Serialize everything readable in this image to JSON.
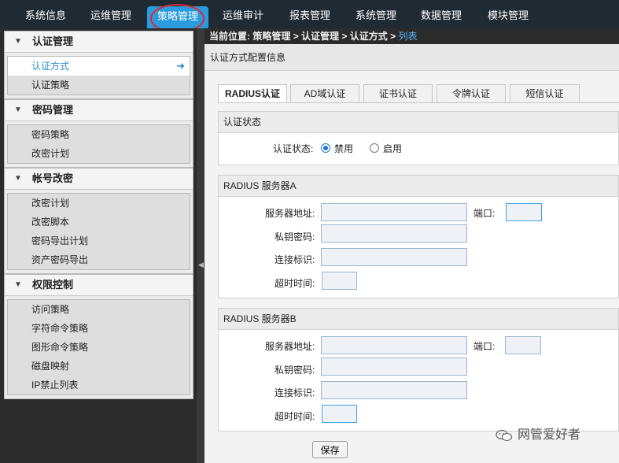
{
  "topnav": {
    "items": [
      {
        "label": "系统信息"
      },
      {
        "label": "运维管理"
      },
      {
        "label": "策略管理",
        "active": true
      },
      {
        "label": "运维审计"
      },
      {
        "label": "报表管理"
      },
      {
        "label": "系统管理"
      },
      {
        "label": "数据管理"
      },
      {
        "label": "模块管理"
      }
    ],
    "active_color": "#2a9bde"
  },
  "sidebar": {
    "groups": [
      {
        "title": "认证管理",
        "items": [
          {
            "label": "认证方式",
            "active": true
          },
          {
            "label": "认证策略"
          }
        ]
      },
      {
        "title": "密码管理",
        "items": [
          {
            "label": "密码策略"
          },
          {
            "label": "改密计划"
          }
        ]
      },
      {
        "title": "帐号改密",
        "items": [
          {
            "label": "改密计划"
          },
          {
            "label": "改密脚本"
          },
          {
            "label": "密码导出计划"
          },
          {
            "label": "资产密码导出"
          }
        ]
      },
      {
        "title": "权限控制",
        "items": [
          {
            "label": "访问策略"
          },
          {
            "label": "字符命令策略"
          },
          {
            "label": "图形命令策略"
          },
          {
            "label": "磁盘映射"
          },
          {
            "label": "IP禁止列表"
          }
        ]
      }
    ]
  },
  "breadcrumb": {
    "prefix": "当前位置: ",
    "parts": [
      "策略管理",
      "认证管理",
      "认证方式"
    ],
    "separator": " > ",
    "current": "列表"
  },
  "panel": {
    "title": "认证方式配置信息",
    "tabs": [
      {
        "label": "RADIUS认证",
        "active": true
      },
      {
        "label": "AD域认证"
      },
      {
        "label": "证书认证"
      },
      {
        "label": "令牌认证"
      },
      {
        "label": "短信认证"
      }
    ],
    "status_section": {
      "title": "认证状态",
      "label": "认证状态:",
      "options": [
        {
          "label": "禁用",
          "selected": true
        },
        {
          "label": "启用"
        }
      ]
    },
    "server_a": {
      "title": "RADIUS 服务器A",
      "address_label": "服务器地址:",
      "port_label": "端口:",
      "key_label": "私钥密码:",
      "conn_label": "连接标识:",
      "timeout_label": "超时时间:",
      "address": "",
      "port": "",
      "key": "",
      "conn": "",
      "timeout": ""
    },
    "server_b": {
      "title": "RADIUS 服务器B",
      "address_label": "服务器地址:",
      "port_label": "端口:",
      "key_label": "私钥密码:",
      "conn_label": "连接标识:",
      "timeout_label": "超时时间:",
      "address": "",
      "port": "",
      "key": "",
      "conn": "",
      "timeout": ""
    },
    "save_label": "保存"
  },
  "watermark": {
    "text": "网管爱好者",
    "icon": "wechat-icon"
  },
  "colors": {
    "accent": "#2a9bde",
    "annotation": "#e0282c",
    "link": "#2b8ed3"
  }
}
